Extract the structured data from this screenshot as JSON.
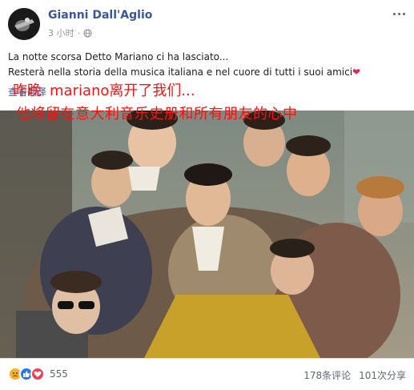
{
  "post": {
    "author": "Gianni Dall'Aglio",
    "time": "3 小时",
    "separator": "·",
    "privacy_icon": "globe-icon",
    "more_icon": "more-options-icon",
    "text_lines": [
      "La notte scorsa Detto Mariano ci ha lasciato...",
      "Resterà nella storia della musica italiana e nel cuore di tutti i suoi amici"
    ],
    "heart_emoji": "❤",
    "see_translation": "查看翻译",
    "overlay": {
      "line1_cn": "昨晚",
      "line1_latin": "mariano离开了我们...",
      "line2": "他将留在意大利音乐史册和所有朋友的心中"
    },
    "reactions": {
      "icons": [
        "sad-reaction-icon",
        "like-reaction-icon",
        "love-reaction-icon"
      ],
      "count": "555"
    },
    "comments": "178条评论",
    "shares": "101次分享"
  },
  "colors": {
    "author_link": "#385898",
    "overlay_text": "#ff1010",
    "like": "#2078f4",
    "love": "#f33e58",
    "sad": "#f7b125"
  }
}
